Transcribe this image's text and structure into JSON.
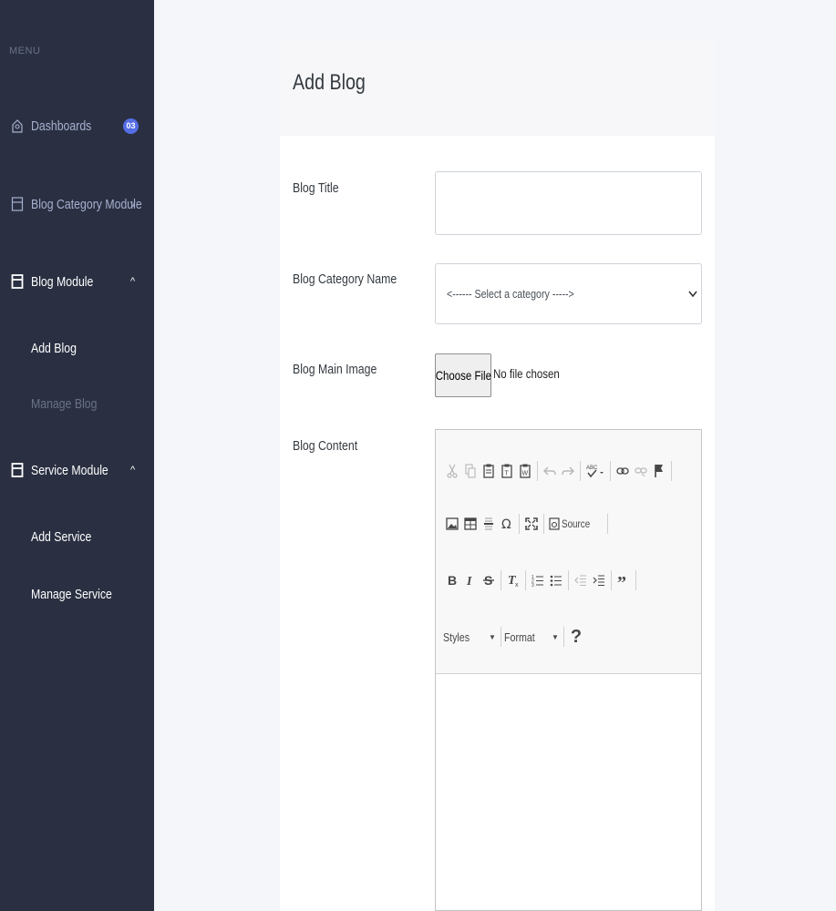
{
  "sidebar": {
    "menu_title": "MENU",
    "items": [
      {
        "label": "Dashboards",
        "badge": "03",
        "icon": "home-icon"
      },
      {
        "label": "Blog Category Module",
        "chevron": "v",
        "icon": "layout-icon"
      },
      {
        "label": "Blog Module",
        "chevron": "^",
        "icon": "layout-icon"
      },
      {
        "label": "Service Module",
        "chevron": "^",
        "icon": "layout-icon"
      }
    ],
    "blog_sub": [
      {
        "label": "Add Blog"
      },
      {
        "label": "Manage Blog"
      }
    ],
    "service_sub": [
      {
        "label": "Add Service"
      },
      {
        "label": "Manage Service"
      }
    ]
  },
  "card": {
    "title": "Add Blog"
  },
  "form": {
    "title_label": "Blog Title",
    "title_value": "",
    "category_label": "Blog Category Name",
    "category_selected": "<------ Select a category ----->",
    "image_label": "Blog Main Image",
    "file_button": "Choose File",
    "file_status": "No file chosen",
    "content_label": "Blog Content"
  },
  "editor": {
    "source_label": "Source",
    "styles_label": "Styles",
    "format_label": "Format",
    "help_label": "?"
  },
  "colors": {
    "sidebar_bg": "#2a3042",
    "badge_bg": "#556ee6",
    "page_bg": "#f5f6f9"
  }
}
